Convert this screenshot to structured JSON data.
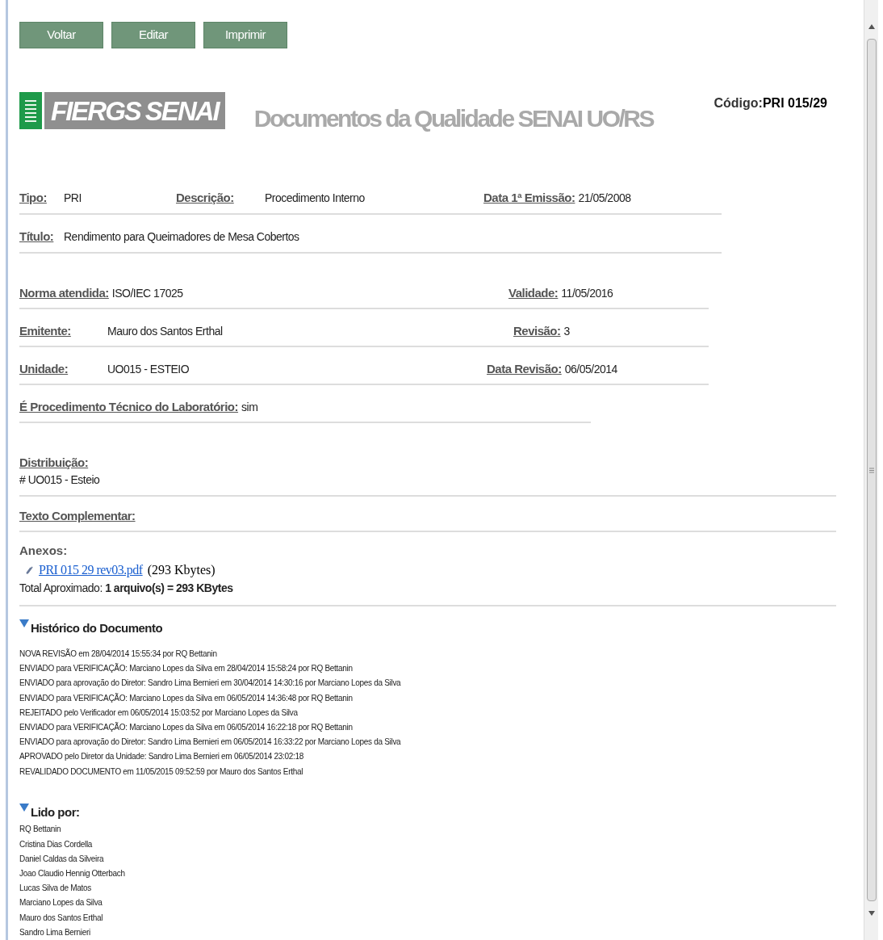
{
  "toolbar": {
    "buttons": [
      "Voltar",
      "Editar",
      "Imprimir"
    ]
  },
  "header": {
    "logo_words": [
      "FIERGS",
      "SENAI"
    ],
    "title": "Documentos da Qualidade SENAI UO/RS",
    "code_label": "Código:",
    "code_value": "PRI 015/29"
  },
  "top_rows": [
    [
      {
        "label": "Tipo:",
        "value": "PRI"
      },
      {
        "label": "Descrição:",
        "value": "Procedimento Interno"
      },
      {
        "label": "Data 1ª Emissão:",
        "value": "21/05/2008"
      }
    ],
    [
      {
        "label": "Título:",
        "value": "Rendimento para Queimadores de Mesa Cobertos"
      }
    ]
  ],
  "detail_rows": [
    [
      {
        "label": "Norma atendida:",
        "value": "ISO/IEC 17025"
      },
      {
        "label": "Validade:",
        "value": "11/05/2016"
      }
    ],
    [
      {
        "label": "Emitente:",
        "value": "Mauro dos Santos Erthal"
      },
      {
        "label": "Revisão:",
        "value": "3"
      }
    ],
    [
      {
        "label": "Unidade:",
        "value": "UO015 - ESTEIO"
      },
      {
        "label": "Data Revisão:",
        "value": "06/05/2014"
      }
    ],
    [
      {
        "label": "É Procedimento Técnico do Laboratório:",
        "value": "sim"
      }
    ]
  ],
  "distribuicao": {
    "label": "Distribuição:",
    "value": "# UO015 - Esteio"
  },
  "texto_complementar": {
    "label": "Texto Complementar:"
  },
  "anexos": {
    "label": "Anexos:",
    "file": "PRI 015  29 rev03.pdf",
    "size": "(293 Kbytes)",
    "total": "Total Aproximado: **1 arquivo(s) = 293 KBytes**"
  },
  "historico": {
    "title": "Histórico do Documento",
    "expanded": true,
    "entries": [
      "NOVA REVISÃO em 28/04/2014 15:55:34 por RQ Bettanin",
      "ENVIADO para VERIFICAÇÃO: Marciano Lopes da Silva em 28/04/2014 15:58:24 por RQ Bettanin",
      "ENVIADO para aprovação do Diretor: Sandro Lima Bernieri em 30/04/2014 14:30:16 por Marciano Lopes da Silva",
      "ENVIADO para VERIFICAÇÃO: Marciano Lopes da Silva em 06/05/2014 14:36:48 por RQ Bettanin",
      "REJEITADO pelo Verificador em 06/05/2014 15:03:52 por Marciano Lopes da Silva",
      "ENVIADO para VERIFICAÇÃO: Marciano Lopes da Silva em 06/05/2014 16:22:18 por RQ Bettanin",
      "ENVIADO para aprovação do Diretor: Sandro Lima Bernieri em 06/05/2014 16:33:22 por Marciano Lopes da Silva",
      "APROVADO pelo Diretor da Unidade: Sandro Lima Bernieri em 06/05/2014 23:02:18",
      "REVALIDADO DOCUMENTO em 11/05/2015 09:52:59 por Mauro dos Santos Erthal"
    ]
  },
  "lido_por": {
    "title": "Lido por:",
    "expanded": true,
    "names": [
      "RQ Bettanin",
      "Cristina Dias Cordella",
      "Daniel Caldas da Silveira",
      "Joao Claudio Hennig Otterbach",
      "Lucas Silva de Matos",
      "Marciano Lopes da Silva",
      "Mauro dos Santos Erthal",
      "Sandro Lima Bernieri"
    ]
  }
}
